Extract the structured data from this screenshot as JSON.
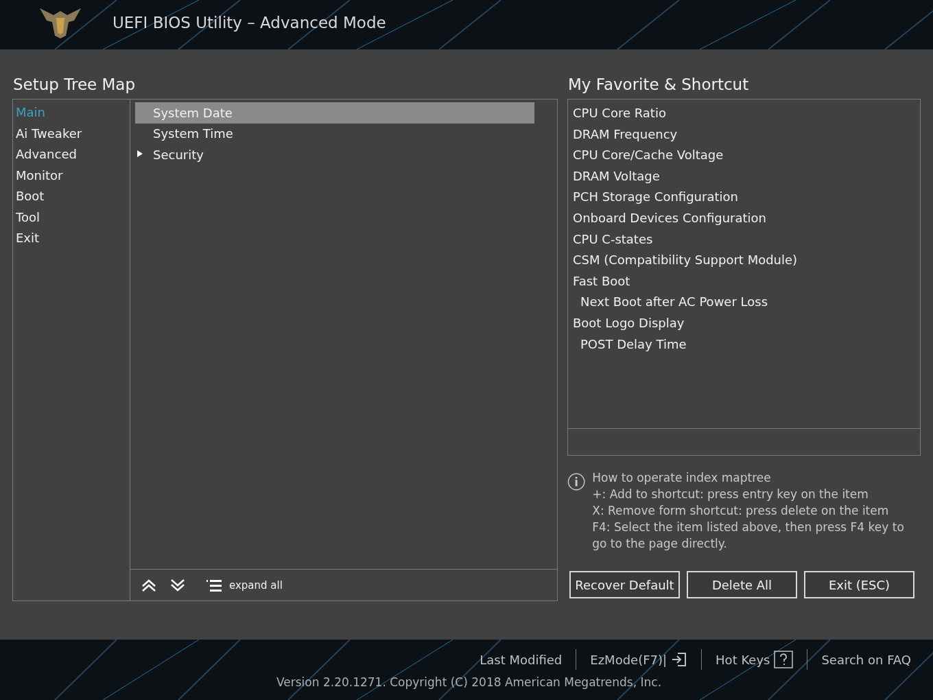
{
  "window": {
    "title": "UEFI BIOS Utility – Advanced Mode"
  },
  "setup_tree_map": {
    "title": "Setup Tree Map",
    "categories": [
      {
        "label": "Main",
        "selected": true
      },
      {
        "label": "Ai Tweaker",
        "selected": false
      },
      {
        "label": "Advanced",
        "selected": false
      },
      {
        "label": "Monitor",
        "selected": false
      },
      {
        "label": "Boot",
        "selected": false
      },
      {
        "label": "Tool",
        "selected": false
      },
      {
        "label": "Exit",
        "selected": false
      }
    ],
    "items": [
      {
        "label": "System Date",
        "selected": true,
        "kind": "leaf"
      },
      {
        "label": "System Time",
        "selected": false,
        "kind": "leaf"
      },
      {
        "label": "Security",
        "selected": false,
        "kind": "branch",
        "expanded": false
      }
    ],
    "toolbar": {
      "expand_label": "expand all"
    }
  },
  "favorites": {
    "title": "My Favorite & Shortcut",
    "items": [
      {
        "label": "CPU Core Ratio"
      },
      {
        "label": "DRAM Frequency"
      },
      {
        "label": "CPU Core/Cache Voltage"
      },
      {
        "label": "DRAM Voltage"
      },
      {
        "label": "PCH Storage Configuration"
      },
      {
        "label": "Onboard Devices Configuration"
      },
      {
        "label": "CPU C-states"
      },
      {
        "label": "CSM (Compatibility Support Module)"
      },
      {
        "label": "Fast Boot",
        "children": [
          {
            "label": "Next Boot after AC Power Loss"
          }
        ]
      },
      {
        "label": "Boot Logo Display",
        "children": [
          {
            "label": "POST Delay Time"
          }
        ]
      }
    ],
    "help": [
      "How to operate index maptree",
      "+: Add to shortcut: press entry key on the item",
      "X: Remove form shortcut: press delete on the item",
      "F4: Select the item listed above, then press F4 key to go to the page directly."
    ],
    "buttons": [
      "Recover Default",
      "Delete All",
      "Exit (ESC)"
    ]
  },
  "footer": {
    "links": [
      {
        "label": "Last Modified",
        "kind": "text"
      },
      {
        "label": "EzMode(F7)|",
        "kind": "exit"
      },
      {
        "label": "Hot Keys",
        "kind": "help"
      },
      {
        "label": "Search on FAQ",
        "kind": "text"
      }
    ],
    "copyright": "Version 2.20.1271. Copyright (C) 2018 American Megatrends, Inc."
  }
}
